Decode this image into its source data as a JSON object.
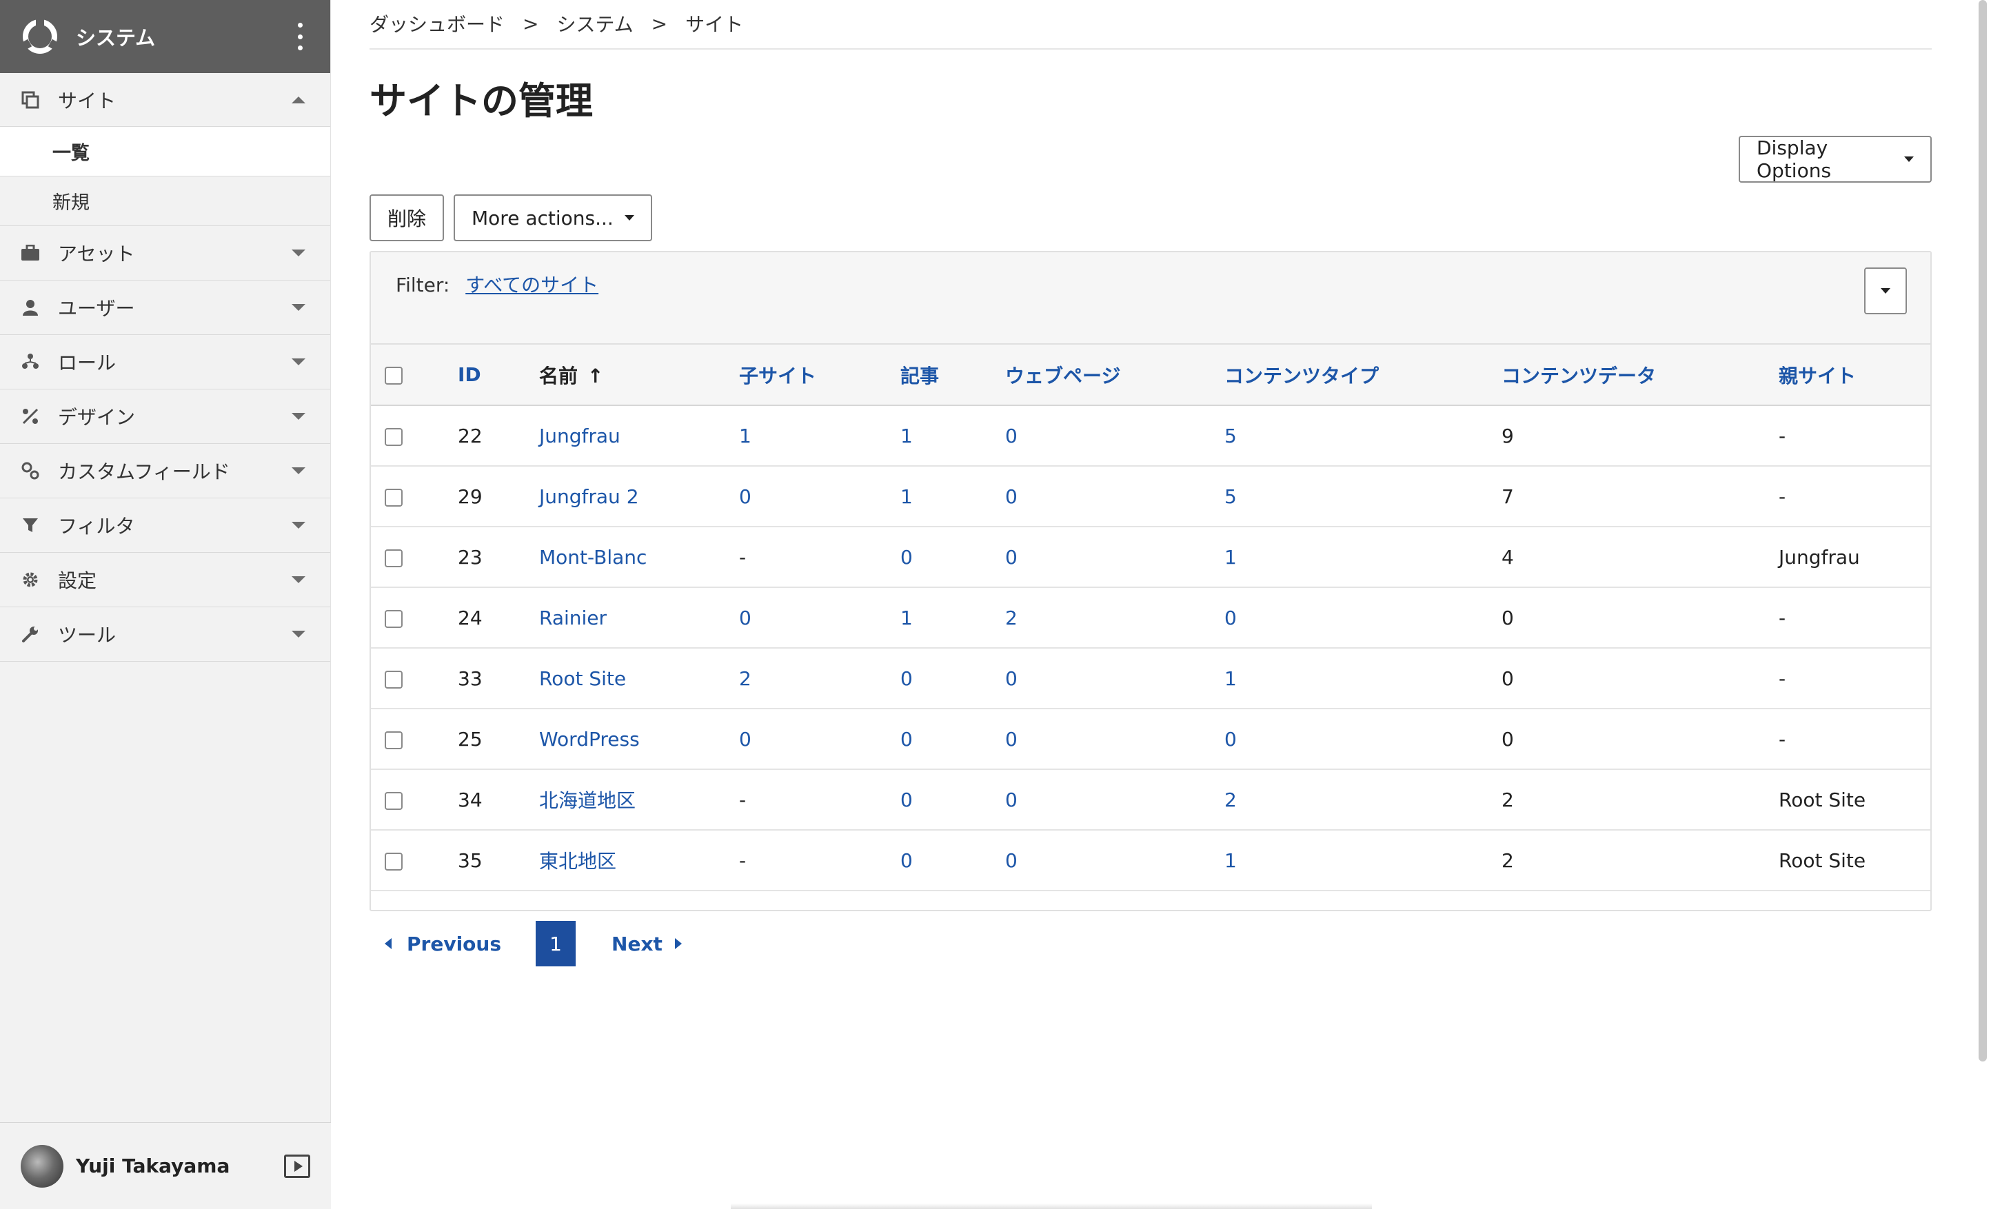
{
  "sidebar": {
    "title": "システム",
    "nav": [
      {
        "label": "サイト",
        "icon": "site-icon",
        "expanded": true
      },
      {
        "label": "アセット",
        "icon": "briefcase-icon"
      },
      {
        "label": "ユーザー",
        "icon": "user-icon"
      },
      {
        "label": "ロール",
        "icon": "role-icon"
      },
      {
        "label": "デザイン",
        "icon": "design-icon"
      },
      {
        "label": "カスタムフィールド",
        "icon": "cogs-icon"
      },
      {
        "label": "フィルタ",
        "icon": "filter-icon"
      },
      {
        "label": "設定",
        "icon": "gear-icon"
      },
      {
        "label": "ツール",
        "icon": "wrench-icon"
      }
    ],
    "site_sub": [
      {
        "label": "一覧",
        "active": true
      },
      {
        "label": "新規"
      }
    ],
    "user": {
      "name": "Yuji Takayama"
    }
  },
  "breadcrumb": [
    "ダッシュボード",
    "システム",
    "サイト"
  ],
  "breadcrumb_sep": ">",
  "page_title": "サイトの管理",
  "display_options": "Display Options",
  "actions": {
    "delete": "削除",
    "more": "More actions..."
  },
  "filter": {
    "label": "Filter:",
    "value": "すべてのサイト"
  },
  "table": {
    "headers": [
      "ID",
      "名前",
      "子サイト",
      "記事",
      "ウェブページ",
      "コンテンツタイプ",
      "コンテンツデータ",
      "親サイト"
    ],
    "sort_arrow": "↑",
    "rows": [
      [
        "22",
        "Jungfrau",
        "1",
        "1",
        "0",
        "5",
        "9",
        "-"
      ],
      [
        "29",
        "Jungfrau 2",
        "0",
        "1",
        "0",
        "5",
        "7",
        "-"
      ],
      [
        "23",
        "Mont-Blanc",
        "-",
        "0",
        "0",
        "1",
        "4",
        "Jungfrau"
      ],
      [
        "24",
        "Rainier",
        "0",
        "1",
        "2",
        "0",
        "0",
        "-"
      ],
      [
        "33",
        "Root Site",
        "2",
        "0",
        "0",
        "1",
        "0",
        "-"
      ],
      [
        "25",
        "WordPress",
        "0",
        "0",
        "0",
        "0",
        "0",
        "-"
      ],
      [
        "34",
        "北海道地区",
        "-",
        "0",
        "0",
        "2",
        "2",
        "Root Site"
      ],
      [
        "35",
        "東北地区",
        "-",
        "0",
        "0",
        "1",
        "2",
        "Root Site"
      ]
    ]
  },
  "pager": {
    "previous": "Previous",
    "page": "1",
    "next": "Next"
  },
  "colors": {
    "link": "#1d56a8",
    "sidebar_header": "#5e5e5e",
    "page_active": "#1d4e9e"
  }
}
